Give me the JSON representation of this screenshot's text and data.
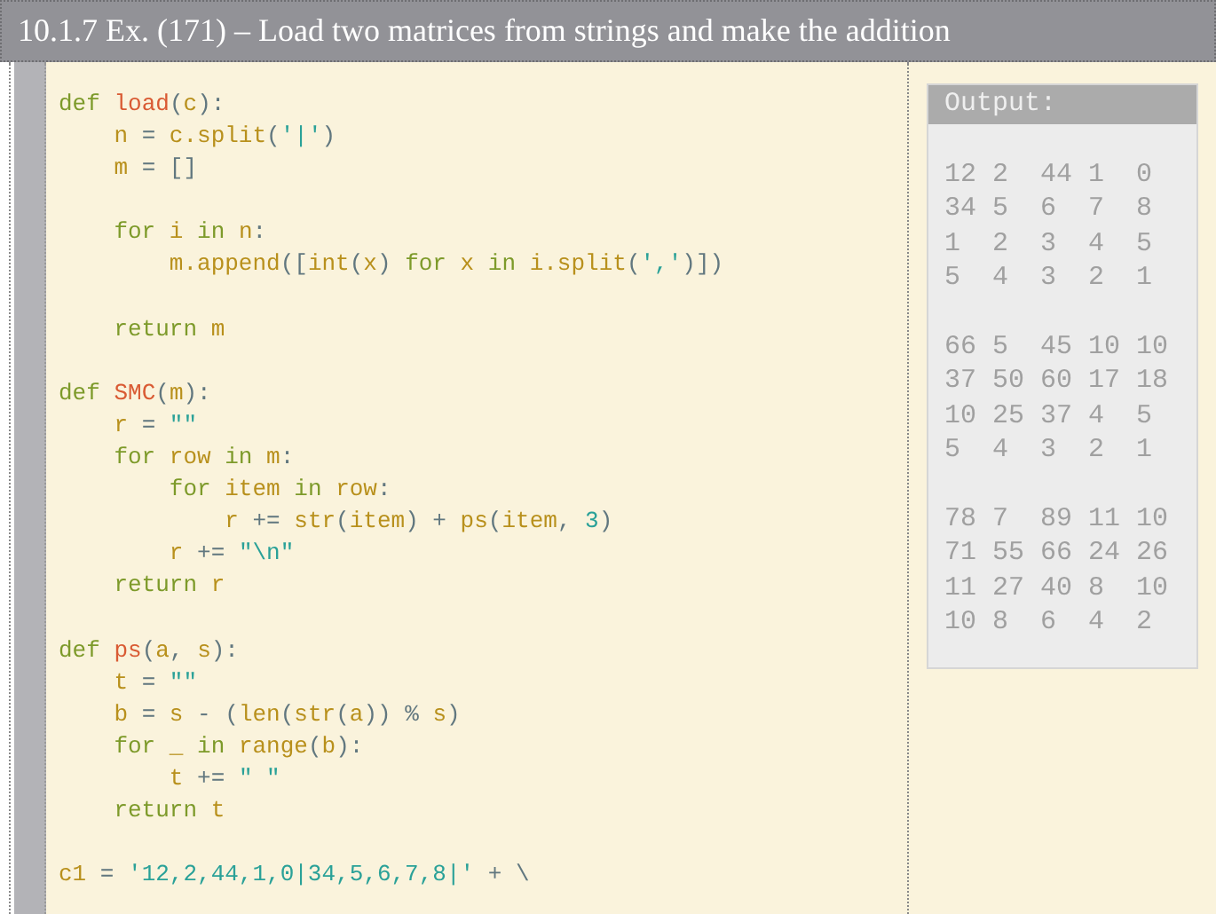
{
  "title": "10.1.7 Ex. (171) – Load two matrices from strings and make the addition",
  "code": {
    "lines": [
      {
        "kind": "code",
        "tokens": [
          {
            "kind": "kw",
            "text": "def "
          },
          {
            "kind": "fn",
            "text": "load"
          },
          {
            "kind": "op",
            "text": "("
          },
          {
            "kind": "id",
            "text": "c"
          },
          {
            "kind": "op",
            "text": "):"
          }
        ]
      },
      {
        "kind": "code",
        "tokens": [
          {
            "kind": "id",
            "text": "    n"
          },
          {
            "kind": "op",
            "text": " = "
          },
          {
            "kind": "id",
            "text": "c.split"
          },
          {
            "kind": "op",
            "text": "("
          },
          {
            "kind": "str",
            "text": "'|'"
          },
          {
            "kind": "op",
            "text": ")"
          }
        ]
      },
      {
        "kind": "code",
        "tokens": [
          {
            "kind": "id",
            "text": "    m"
          },
          {
            "kind": "op",
            "text": " = []"
          }
        ]
      },
      {
        "kind": "blank"
      },
      {
        "kind": "code",
        "tokens": [
          {
            "kind": "kw",
            "text": "    for "
          },
          {
            "kind": "id",
            "text": "i"
          },
          {
            "kind": "kw",
            "text": " in "
          },
          {
            "kind": "id",
            "text": "n"
          },
          {
            "kind": "op",
            "text": ":"
          }
        ]
      },
      {
        "kind": "code",
        "tokens": [
          {
            "kind": "id",
            "text": "        m.append"
          },
          {
            "kind": "op",
            "text": "(["
          },
          {
            "kind": "id",
            "text": "int"
          },
          {
            "kind": "op",
            "text": "("
          },
          {
            "kind": "id",
            "text": "x"
          },
          {
            "kind": "op",
            "text": ")"
          },
          {
            "kind": "kw",
            "text": " for "
          },
          {
            "kind": "id",
            "text": "x"
          },
          {
            "kind": "kw",
            "text": " in "
          },
          {
            "kind": "id",
            "text": "i.split"
          },
          {
            "kind": "op",
            "text": "("
          },
          {
            "kind": "str",
            "text": "','"
          },
          {
            "kind": "op",
            "text": ")])"
          }
        ]
      },
      {
        "kind": "blank"
      },
      {
        "kind": "code",
        "tokens": [
          {
            "kind": "kw",
            "text": "    return "
          },
          {
            "kind": "id",
            "text": "m"
          }
        ]
      },
      {
        "kind": "blank"
      },
      {
        "kind": "code",
        "tokens": [
          {
            "kind": "kw",
            "text": "def "
          },
          {
            "kind": "fn",
            "text": "SMC"
          },
          {
            "kind": "op",
            "text": "("
          },
          {
            "kind": "id",
            "text": "m"
          },
          {
            "kind": "op",
            "text": "):"
          }
        ]
      },
      {
        "kind": "code",
        "tokens": [
          {
            "kind": "id",
            "text": "    r"
          },
          {
            "kind": "op",
            "text": " = "
          },
          {
            "kind": "str",
            "text": "\"\""
          }
        ]
      },
      {
        "kind": "code",
        "tokens": [
          {
            "kind": "kw",
            "text": "    for "
          },
          {
            "kind": "id",
            "text": "row"
          },
          {
            "kind": "kw",
            "text": " in "
          },
          {
            "kind": "id",
            "text": "m"
          },
          {
            "kind": "op",
            "text": ":"
          }
        ]
      },
      {
        "kind": "code",
        "tokens": [
          {
            "kind": "kw",
            "text": "        for "
          },
          {
            "kind": "id",
            "text": "item"
          },
          {
            "kind": "kw",
            "text": " in "
          },
          {
            "kind": "id",
            "text": "row"
          },
          {
            "kind": "op",
            "text": ":"
          }
        ]
      },
      {
        "kind": "code",
        "tokens": [
          {
            "kind": "id",
            "text": "            r"
          },
          {
            "kind": "op",
            "text": " += "
          },
          {
            "kind": "id",
            "text": "str"
          },
          {
            "kind": "op",
            "text": "("
          },
          {
            "kind": "id",
            "text": "item"
          },
          {
            "kind": "op",
            "text": ") + "
          },
          {
            "kind": "id",
            "text": "ps"
          },
          {
            "kind": "op",
            "text": "("
          },
          {
            "kind": "id",
            "text": "item"
          },
          {
            "kind": "op",
            "text": ", "
          },
          {
            "kind": "num",
            "text": "3"
          },
          {
            "kind": "op",
            "text": ")"
          }
        ]
      },
      {
        "kind": "code",
        "tokens": [
          {
            "kind": "id",
            "text": "        r"
          },
          {
            "kind": "op",
            "text": " += "
          },
          {
            "kind": "str",
            "text": "\"\\n\""
          }
        ]
      },
      {
        "kind": "code",
        "tokens": [
          {
            "kind": "kw",
            "text": "    return "
          },
          {
            "kind": "id",
            "text": "r"
          }
        ]
      },
      {
        "kind": "blank"
      },
      {
        "kind": "code",
        "tokens": [
          {
            "kind": "kw",
            "text": "def "
          },
          {
            "kind": "fn",
            "text": "ps"
          },
          {
            "kind": "op",
            "text": "("
          },
          {
            "kind": "id",
            "text": "a"
          },
          {
            "kind": "op",
            "text": ", "
          },
          {
            "kind": "id",
            "text": "s"
          },
          {
            "kind": "op",
            "text": "):"
          }
        ]
      },
      {
        "kind": "code",
        "tokens": [
          {
            "kind": "id",
            "text": "    t"
          },
          {
            "kind": "op",
            "text": " = "
          },
          {
            "kind": "str",
            "text": "\"\""
          }
        ]
      },
      {
        "kind": "code",
        "tokens": [
          {
            "kind": "id",
            "text": "    b"
          },
          {
            "kind": "op",
            "text": " = "
          },
          {
            "kind": "id",
            "text": "s"
          },
          {
            "kind": "op",
            "text": " - ("
          },
          {
            "kind": "id",
            "text": "len"
          },
          {
            "kind": "op",
            "text": "("
          },
          {
            "kind": "id",
            "text": "str"
          },
          {
            "kind": "op",
            "text": "("
          },
          {
            "kind": "id",
            "text": "a"
          },
          {
            "kind": "op",
            "text": ")) % "
          },
          {
            "kind": "id",
            "text": "s"
          },
          {
            "kind": "op",
            "text": ")"
          }
        ]
      },
      {
        "kind": "code",
        "tokens": [
          {
            "kind": "kw",
            "text": "    for "
          },
          {
            "kind": "id",
            "text": "_"
          },
          {
            "kind": "kw",
            "text": " in "
          },
          {
            "kind": "id",
            "text": "range"
          },
          {
            "kind": "op",
            "text": "("
          },
          {
            "kind": "id",
            "text": "b"
          },
          {
            "kind": "op",
            "text": "):"
          }
        ]
      },
      {
        "kind": "code",
        "tokens": [
          {
            "kind": "id",
            "text": "        t"
          },
          {
            "kind": "op",
            "text": " += "
          },
          {
            "kind": "str",
            "text": "\" \""
          }
        ]
      },
      {
        "kind": "code",
        "tokens": [
          {
            "kind": "kw",
            "text": "    return "
          },
          {
            "kind": "id",
            "text": "t"
          }
        ]
      },
      {
        "kind": "blank"
      },
      {
        "kind": "code",
        "tokens": [
          {
            "kind": "id",
            "text": "c1"
          },
          {
            "kind": "op",
            "text": " = "
          },
          {
            "kind": "str",
            "text": "'12,2,44,1,0|34,5,6,7,8|'"
          },
          {
            "kind": "op",
            "text": " + \\"
          }
        ]
      }
    ]
  },
  "output": {
    "label": "Output:",
    "blocks": [
      [
        "12 2  44 1  0",
        "34 5  6  7  8",
        "1  2  3  4  5",
        "5  4  3  2  1"
      ],
      [
        "66 5  45 10 10",
        "37 50 60 17 18",
        "10 25 37 4  5",
        "5  4  3  2  1"
      ],
      [
        "78 7  89 11 10",
        "71 55 66 24 26",
        "11 27 40 8  10",
        "10 8  6  4  2"
      ]
    ]
  }
}
